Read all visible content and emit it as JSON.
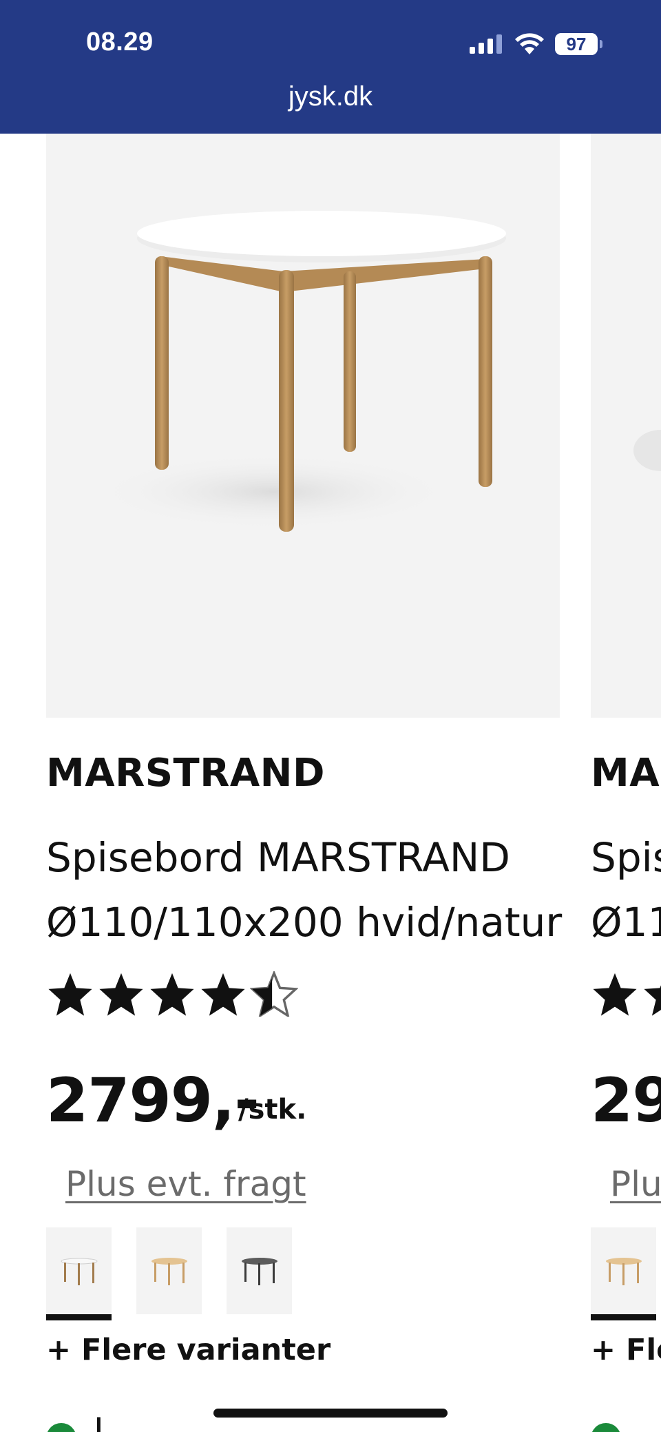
{
  "status_bar": {
    "time": "08.29",
    "battery": "97",
    "url": "jysk.dk",
    "background": "#243a86"
  },
  "product": {
    "brand": "MARSTRAND",
    "title_line1": "Spisebord MARSTRAND",
    "title_line2": "Ø110/110x200 hvid/natur",
    "rating": 4.5,
    "rating_max": 5,
    "price": "2799,-",
    "unit": "/stk.",
    "freight_link": "Plus evt. fragt",
    "variants": [
      {
        "name": "variant-white-natural",
        "selected": true
      },
      {
        "name": "variant-natural",
        "selected": false
      },
      {
        "name": "variant-dark",
        "selected": false
      }
    ],
    "more_variants": "+ Flere varianter",
    "stock_partial": "L"
  },
  "next_product_peek": {
    "brand": "MA",
    "title_line1": "Spis",
    "title_line2": "Ø11",
    "price": "29",
    "freight_link": "Plu",
    "more_variants": "+ Fle"
  }
}
